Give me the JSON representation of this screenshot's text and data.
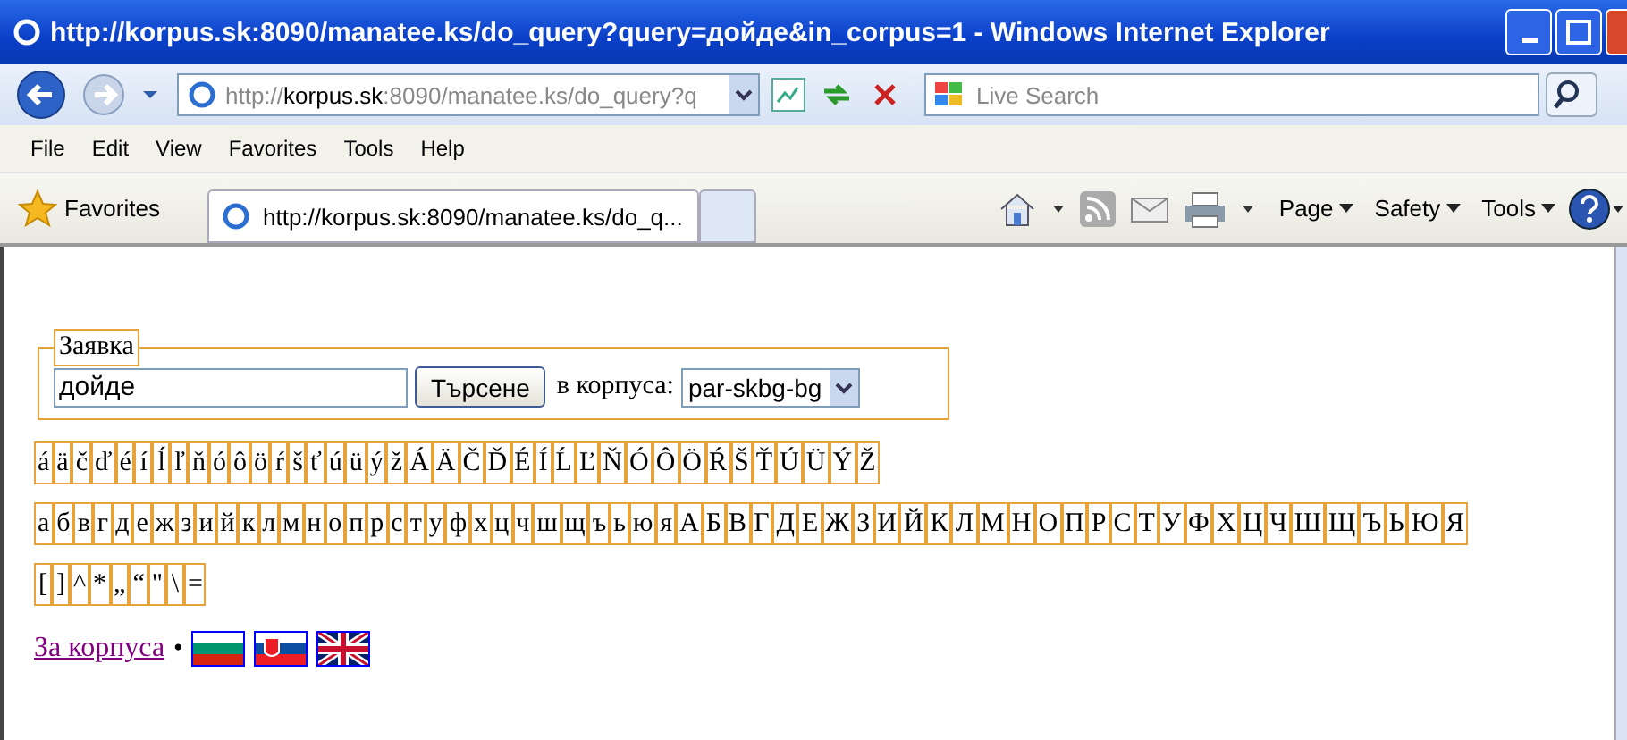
{
  "window": {
    "title": "http://korpus.sk:8090/manatee.ks/do_query?query=дойде&in_corpus=1 - Windows Internet Explorer"
  },
  "address_bar": {
    "prefix": "http://",
    "host": "korpus.sk",
    "rest": ":8090/manatee.ks/do_query?q"
  },
  "search": {
    "placeholder": "Live Search"
  },
  "menu": [
    "File",
    "Edit",
    "View",
    "Favorites",
    "Tools",
    "Help"
  ],
  "favorites_bar": {
    "favorites": "Favorites",
    "tab": "http://korpus.sk:8090/manatee.ks/do_q...",
    "commands": [
      "Page",
      "Safety",
      "Tools"
    ]
  },
  "form": {
    "legend": "Заявка",
    "query": "дойде",
    "button": "Търсене",
    "corpus_label": "в корпуса:",
    "corpus": "par-skbg-bg"
  },
  "keyboard_rows": [
    [
      "á",
      "ä",
      "č",
      "ď",
      "é",
      "í",
      "ĺ",
      "ľ",
      "ň",
      "ó",
      "ô",
      "ö",
      "ŕ",
      "š",
      "ť",
      "ú",
      "ü",
      "ý",
      "ž",
      "Á",
      "Ä",
      "Č",
      "Ď",
      "É",
      "Í",
      "Ĺ",
      "Ľ",
      "Ň",
      "Ó",
      "Ô",
      "Ö",
      "Ŕ",
      "Š",
      "Ť",
      "Ú",
      "Ü",
      "Ý",
      "Ž"
    ],
    [
      "а",
      "б",
      "в",
      "г",
      "д",
      "е",
      "ж",
      "з",
      "и",
      "й",
      "к",
      "л",
      "м",
      "н",
      "о",
      "п",
      "р",
      "с",
      "т",
      "у",
      "ф",
      "х",
      "ц",
      "ч",
      "ш",
      "щ",
      "ъ",
      "ь",
      "ю",
      "я",
      "А",
      "Б",
      "В",
      "Г",
      "Д",
      "Е",
      "Ж",
      "З",
      "И",
      "Й",
      "К",
      "Л",
      "М",
      "Н",
      "О",
      "П",
      "Р",
      "С",
      "Т",
      "У",
      "Ф",
      "Х",
      "Ц",
      "Ч",
      "Ш",
      "Щ",
      "Ъ",
      "Ь",
      "Ю",
      "Я"
    ],
    [
      "[",
      "]",
      "^",
      "*",
      "„",
      "“",
      "\"",
      "\\",
      "="
    ]
  ],
  "footer": {
    "link": "За корпуса",
    "separator": "•",
    "flags": [
      {
        "kind": "bg"
      },
      {
        "kind": "sk"
      },
      {
        "kind": "uk"
      }
    ]
  }
}
